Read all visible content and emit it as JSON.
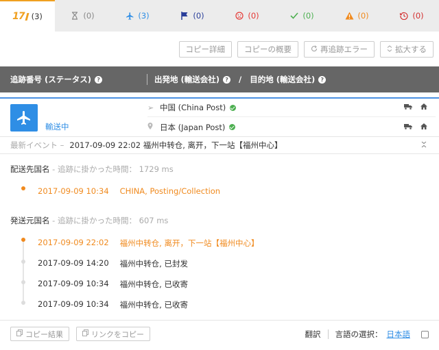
{
  "tabs": [
    {
      "icon": "17track-logo",
      "brand": "17",
      "count": "(3)",
      "color": "#333333"
    },
    {
      "icon": "hourglass-icon",
      "count": "(0)",
      "color": "#888888"
    },
    {
      "icon": "plane-icon",
      "count": "(3)",
      "color": "#2f8ee5"
    },
    {
      "icon": "flag-icon",
      "count": "(0)",
      "color": "#2a3f9a"
    },
    {
      "icon": "sad-face-icon",
      "count": "(0)",
      "color": "#e53935"
    },
    {
      "icon": "check-icon",
      "count": "(0)",
      "color": "#4caf50"
    },
    {
      "icon": "warning-icon",
      "count": "(0)",
      "color": "#f08a1e"
    },
    {
      "icon": "history-icon",
      "count": "(0)",
      "color": "#d32f2f"
    }
  ],
  "toolbar": {
    "copy_detail": "コピー詳細",
    "copy_summary": "コピーの概要",
    "retrack_error": "再追跡エラー",
    "expand": "拡大する"
  },
  "header": {
    "col1": "追跡番号 (ステータス)",
    "col2": "出発地 (輸送会社)",
    "slash": "/",
    "col3": "目的地 (輸送会社)"
  },
  "item": {
    "status": "輸送中",
    "origin": "中国 (China Post)",
    "destination": "日本 (Japan Post)"
  },
  "latest": {
    "label": "最新イベント –",
    "text": "2017-09-09 22:02 福州中转仓, 离开，下一站【福州中心】"
  },
  "dest_section": {
    "title": "配送先国名",
    "time_label": "- 追跡に掛かった時間：",
    "time_value": "1729 ms",
    "events": [
      {
        "time": "2017-09-09 10:34",
        "desc": "CHINA, Posting/Collection"
      }
    ]
  },
  "origin_section": {
    "title": "発送元国名",
    "time_label": "- 追跡に掛かった時間：",
    "time_value": "607 ms",
    "events": [
      {
        "time": "2017-09-09 22:02",
        "desc": "福州中转仓, 离开，下一站【福州中心】"
      },
      {
        "time": "2017-09-09 14:20",
        "desc": "福州中转仓, 已封发"
      },
      {
        "time": "2017-09-09 10:34",
        "desc": "福州中转仓, 已收寄"
      },
      {
        "time": "2017-09-09 10:34",
        "desc": "福州中转仓, 已收寄"
      }
    ]
  },
  "footer": {
    "copy_result": "コピー結果",
    "copy_link": "リンクをコピー",
    "translate": "翻訳",
    "lang_label": "言語の選択：",
    "lang_value": "日本語"
  },
  "colors": {
    "accent": "#2f8ee5",
    "orange": "#f08a1e",
    "header_bg": "#666666",
    "active_tab": "#f0a020"
  }
}
